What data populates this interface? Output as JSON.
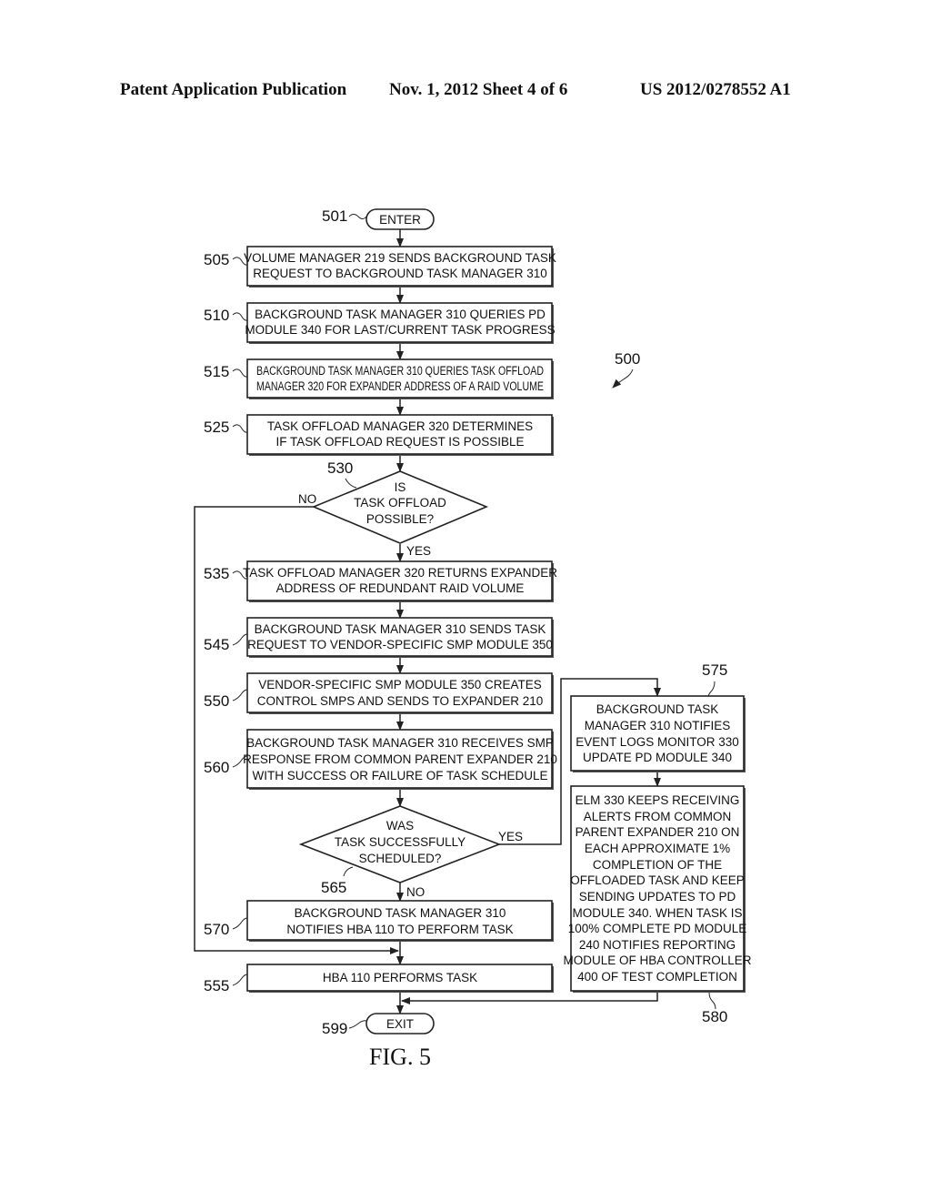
{
  "header": {
    "publication": "Patent Application Publication",
    "date_sheet": "Nov. 1, 2012   Sheet 4 of 6",
    "number": "US 2012/0278552 A1"
  },
  "figure": {
    "label": "FIG. 5",
    "ref": "500"
  },
  "terminals": {
    "enter": {
      "ref": "501",
      "label": "ENTER"
    },
    "exit": {
      "ref": "599",
      "label": "EXIT"
    }
  },
  "steps": {
    "s505": {
      "ref": "505",
      "lines": [
        "VOLUME MANAGER 219 SENDS BACKGROUND TASK",
        "REQUEST TO BACKGROUND TASK MANAGER 310"
      ]
    },
    "s510": {
      "ref": "510",
      "lines": [
        "BACKGROUND TASK MANAGER 310 QUERIES PD",
        "MODULE 340 FOR LAST/CURRENT TASK PROGRESS"
      ]
    },
    "s515": {
      "ref": "515",
      "lines": [
        "BACKGROUND TASK MANAGER 310 QUERIES TASK OFFLOAD",
        "MANAGER 320 FOR EXPANDER ADDRESS OF A RAID VOLUME"
      ]
    },
    "s525": {
      "ref": "525",
      "lines": [
        "TASK OFFLOAD MANAGER 320 DETERMINES",
        "IF TASK OFFLOAD REQUEST IS POSSIBLE"
      ]
    },
    "s535": {
      "ref": "535",
      "lines": [
        "TASK OFFLOAD MANAGER 320 RETURNS EXPANDER",
        "ADDRESS OF REDUNDANT RAID VOLUME"
      ]
    },
    "s545": {
      "ref": "545",
      "lines": [
        "BACKGROUND TASK MANAGER 310 SENDS TASK",
        "REQUEST TO VENDOR-SPECIFIC SMP MODULE 350"
      ]
    },
    "s550": {
      "ref": "550",
      "lines": [
        "VENDOR-SPECIFIC SMP MODULE 350 CREATES",
        "CONTROL SMPS AND SENDS TO EXPANDER 210"
      ]
    },
    "s560": {
      "ref": "560",
      "lines": [
        "BACKGROUND TASK MANAGER 310 RECEIVES SMP",
        "RESPONSE FROM COMMON PARENT EXPANDER 210",
        "WITH SUCCESS OR FAILURE OF TASK SCHEDULE"
      ]
    },
    "s570": {
      "ref": "570",
      "lines": [
        "BACKGROUND TASK MANAGER 310",
        "NOTIFIES HBA 110 TO PERFORM TASK"
      ]
    },
    "s555": {
      "ref": "555",
      "lines": [
        "HBA 110 PERFORMS TASK"
      ]
    },
    "s575": {
      "ref": "575",
      "lines": [
        "BACKGROUND TASK",
        "MANAGER 310 NOTIFIES",
        "EVENT LOGS MONITOR 330",
        "UPDATE PD MODULE 340"
      ]
    },
    "s580": {
      "ref": "580",
      "lines": [
        "ELM 330 KEEPS RECEIVING",
        "ALERTS FROM COMMON",
        "PARENT EXPANDER 210 ON",
        "EACH APPROXIMATE 1%",
        "COMPLETION OF THE",
        "OFFLOADED TASK AND KEEP",
        "SENDING UPDATES TO PD",
        "MODULE 340. WHEN TASK IS",
        "100% COMPLETE PD MODULE",
        "240 NOTIFIES REPORTING",
        "MODULE OF HBA CONTROLLER",
        "400 OF TEST COMPLETION"
      ]
    }
  },
  "decisions": {
    "d530": {
      "ref": "530",
      "lines": [
        "IS",
        "TASK OFFLOAD",
        "POSSIBLE?"
      ],
      "yes": "YES",
      "no": "NO"
    },
    "d565": {
      "ref": "565",
      "lines": [
        "WAS",
        "TASK SUCCESSFULLY",
        "SCHEDULED?"
      ],
      "yes": "YES",
      "no": "NO"
    }
  }
}
